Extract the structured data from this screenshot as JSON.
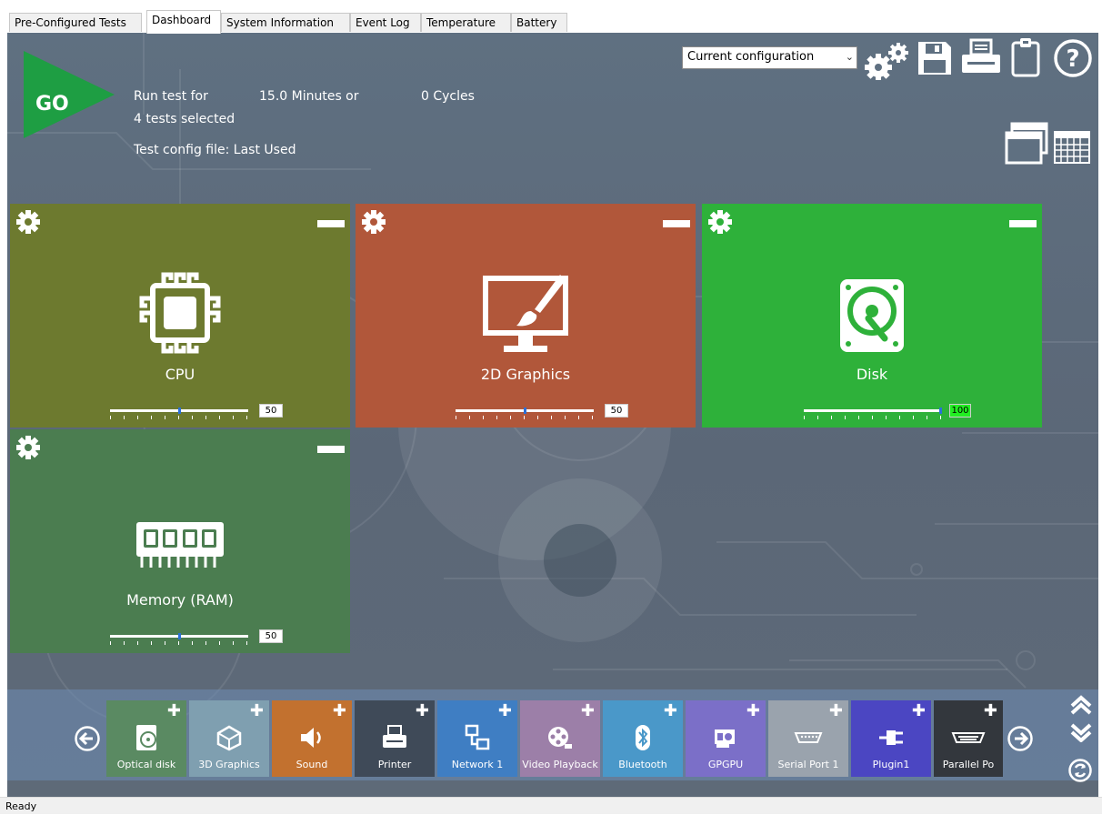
{
  "tabs": [
    {
      "label": "Pre-Configured Tests",
      "active": false
    },
    {
      "label": "Dashboard",
      "active": true
    },
    {
      "label": "System Information",
      "active": false
    },
    {
      "label": "Event Log",
      "active": false
    },
    {
      "label": "Temperature",
      "active": false
    },
    {
      "label": "Battery",
      "active": false
    }
  ],
  "header": {
    "go_label": "GO",
    "run_test_for_label": "Run test for",
    "minutes_value": "15.0 Minutes or",
    "cycles_value": "0 Cycles",
    "tests_selected": "4 tests selected",
    "config_file": "Test config file: Last Used",
    "config_select": "Current configuration"
  },
  "toolbar_icons": [
    "settings-gears-icon",
    "save-icon",
    "print-icon",
    "clipboard-icon",
    "help-icon",
    "window-view-icon",
    "grid-view-icon"
  ],
  "tiles": [
    {
      "name": "CPU",
      "slider_value": "50",
      "slider_fraction": 0.5,
      "color": "#6d7a2f",
      "icon": "cpu-icon"
    },
    {
      "name": "2D Graphics",
      "slider_value": "50",
      "slider_fraction": 0.5,
      "color": "#b1573a",
      "icon": "2d-graphics-icon"
    },
    {
      "name": "Disk",
      "slider_value": "100",
      "slider_fraction": 1.0,
      "color": "#2eb13a",
      "icon": "disk-icon"
    },
    {
      "name": "Memory (RAM)",
      "slider_value": "50",
      "slider_fraction": 0.5,
      "color": "#4b7d50",
      "icon": "memory-icon"
    }
  ],
  "modules": [
    {
      "label": "Optical disk",
      "color": "#5a8a62",
      "icon": "optical-disk-icon"
    },
    {
      "label": "3D Graphics",
      "color": "#7f9fb0",
      "icon": "3d-graphics-icon"
    },
    {
      "label": "Sound",
      "color": "#c2712f",
      "icon": "sound-icon"
    },
    {
      "label": "Printer",
      "color": "#3f4a58",
      "icon": "printer-icon"
    },
    {
      "label": "Network 1",
      "color": "#3f7ec3",
      "icon": "network-icon"
    },
    {
      "label": "Video Playback",
      "color": "#9c7fa8",
      "icon": "video-playback-icon"
    },
    {
      "label": "Bluetooth",
      "color": "#4a98c9",
      "icon": "bluetooth-icon"
    },
    {
      "label": "GPGPU",
      "color": "#7b6fc8",
      "icon": "gpgpu-icon"
    },
    {
      "label": "Serial Port 1",
      "color": "#9aa3ad",
      "icon": "serial-port-icon"
    },
    {
      "label": "Plugin1",
      "color": "#4b46c2",
      "icon": "plugin-icon"
    },
    {
      "label": "Parallel Po",
      "color": "#33373d",
      "icon": "parallel-port-icon"
    }
  ],
  "status_text": "Ready"
}
